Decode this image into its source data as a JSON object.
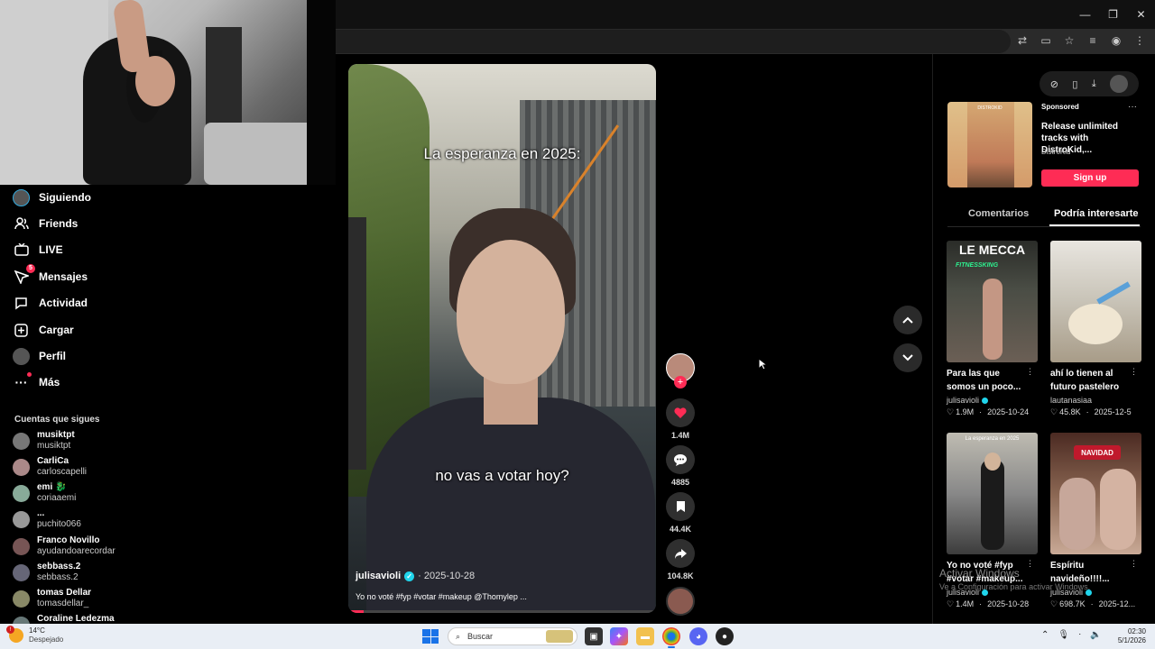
{
  "window": {
    "controls": [
      "—",
      "❐",
      "✕"
    ],
    "toolbar_icons": [
      "translate-icon",
      "cast-icon",
      "star-icon",
      "media-icon",
      "profile-icon",
      "menu-icon"
    ]
  },
  "sidebar": {
    "nav": [
      {
        "label": "Siguiendo",
        "icon": "avatar"
      },
      {
        "label": "Friends",
        "icon": "friends-icon"
      },
      {
        "label": "LIVE",
        "icon": "live-icon"
      },
      {
        "label": "Mensajes",
        "icon": "messages-icon",
        "badge": "5"
      },
      {
        "label": "Actividad",
        "icon": "activity-icon"
      },
      {
        "label": "Cargar",
        "icon": "upload-icon"
      },
      {
        "label": "Perfil",
        "icon": "profile-icon"
      },
      {
        "label": "Más",
        "icon": "more-icon"
      }
    ],
    "following_title": "Cuentas que sigues",
    "following": [
      {
        "name": "musiktpt",
        "handle": "musiktpt"
      },
      {
        "name": "CarliCa",
        "handle": "carloscapelli"
      },
      {
        "name": "emi 🐉",
        "handle": "coriaaemi"
      },
      {
        "name": "...",
        "handle": "puchito066"
      },
      {
        "name": "Franco Novillo",
        "handle": "ayudandoarecordar"
      },
      {
        "name": "sebbass.2",
        "handle": "sebbass.2"
      },
      {
        "name": "tomas Dellar",
        "handle": "tomasdellar_"
      },
      {
        "name": "Coraline Ledezma",
        "handle": ""
      }
    ]
  },
  "video": {
    "caption_top": "La esperanza en 2025:",
    "caption_mid": "no vas a votar hoy?",
    "author": "julisavioli",
    "date": "· 2025-10-28",
    "description": "Yo no voté #fyp #votar #makeup @Thomylep ...",
    "progress": 0.05
  },
  "actions": {
    "likes": "1.4M",
    "comments": "4885",
    "saves": "44.4K",
    "shares": "104.8K"
  },
  "right_panel": {
    "ad": {
      "sponsored": "Sponsored",
      "title": "Release unlimited tracks with DistroKid,...",
      "brand": "DistroKid",
      "thumb_brand": "DISTROKID",
      "cta": "Sign up"
    },
    "tabs": [
      "Comentarios",
      "Podría interesarte"
    ],
    "cards": [
      {
        "title": "Para las que somos un poco...",
        "author": "julisavioli",
        "verified": true,
        "likes": "1.9M",
        "date": "2025-10-24",
        "thumb_text": "LE MECCA",
        "thumb_sub": "FITNESSKING"
      },
      {
        "title": "ahí lo tienen al futuro pastelero",
        "author": "lautanasiaa",
        "verified": false,
        "likes": "45.8K",
        "date": "2025-12-5",
        "thumb_text": "",
        "thumb_sub": ""
      },
      {
        "title": "Yo no voté #fyp #votar #makeup...",
        "author": "julisavioli",
        "verified": true,
        "likes": "1.4M",
        "date": "2025-10-28",
        "thumb_text": "La esperanza en 2025",
        "thumb_sub": ""
      },
      {
        "title": "Espíritu navideño!!!!...",
        "author": "julisavioli",
        "verified": true,
        "likes": "698.7K",
        "date": "2025-12...",
        "thumb_text": "NAVIDAD",
        "thumb_sub": ""
      }
    ],
    "watermark_1": "Activar Windows",
    "watermark_2": "Ve a Configuración para activar Windows."
  },
  "taskbar": {
    "weather_temp": "14°C",
    "weather_cond": "Despejado",
    "search_placeholder": "Buscar",
    "time": "02:30",
    "date": "5/1/2026"
  }
}
